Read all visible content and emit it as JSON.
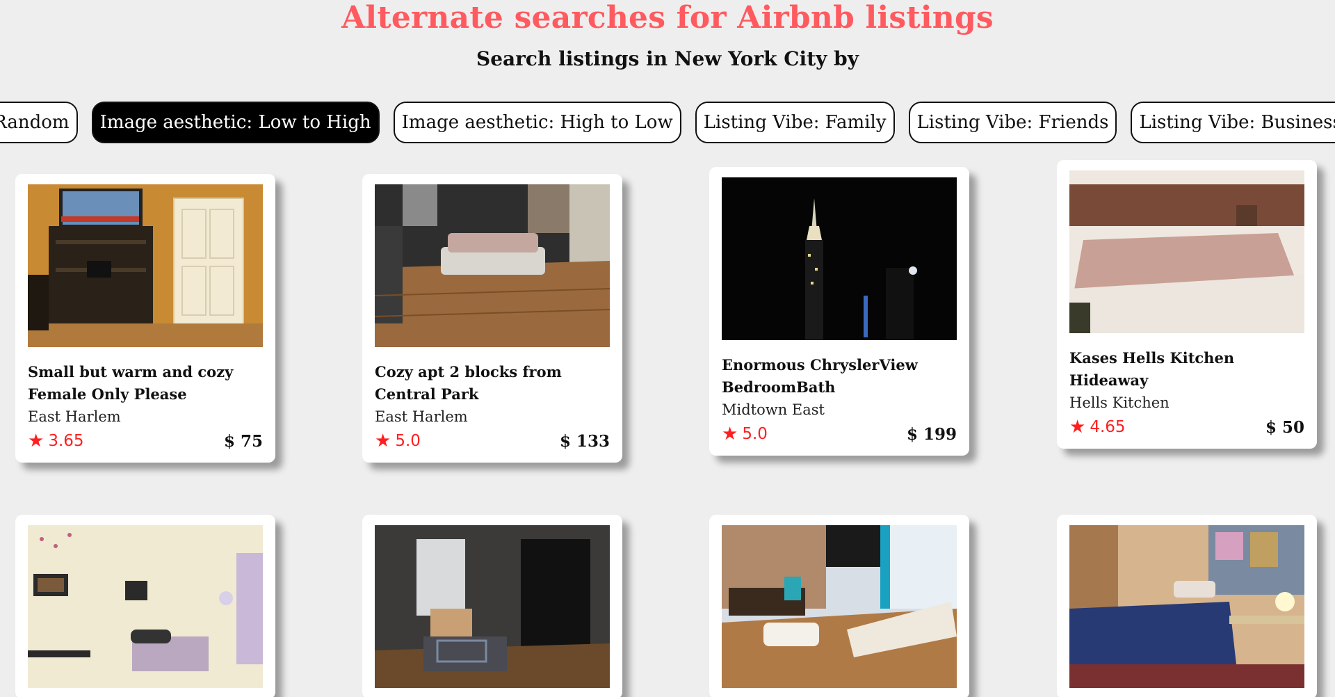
{
  "header": {
    "title": "Alternate searches for Airbnb listings",
    "subtitle": "Search listings in New York City by"
  },
  "filters": [
    {
      "label": "Random",
      "active": false
    },
    {
      "label": "Image aesthetic: Low to High",
      "active": true
    },
    {
      "label": "Image aesthetic: High to Low",
      "active": false
    },
    {
      "label": "Listing Vibe: Family",
      "active": false
    },
    {
      "label": "Listing Vibe: Friends",
      "active": false
    },
    {
      "label": "Listing Vibe: Business",
      "active": false
    }
  ],
  "listings": [
    {
      "title": "Small but warm and cozy Female Only Please",
      "neighborhood": "East Harlem",
      "rating": "3.65",
      "price": "$ 75"
    },
    {
      "title": "Cozy apt 2 blocks from Central Park",
      "neighborhood": "East Harlem",
      "rating": "5.0",
      "price": "$ 133"
    },
    {
      "title": "Enormous ChryslerView BedroomBath",
      "neighborhood": "Midtown East",
      "rating": "5.0",
      "price": "$ 199"
    },
    {
      "title": "Kases Hells Kitchen Hideaway",
      "neighborhood": "Hells Kitchen",
      "rating": "4.65",
      "price": "$ 50"
    },
    {
      "title": "",
      "neighborhood": "",
      "rating": "",
      "price": ""
    },
    {
      "title": "",
      "neighborhood": "",
      "rating": "",
      "price": ""
    },
    {
      "title": "",
      "neighborhood": "",
      "rating": "",
      "price": ""
    },
    {
      "title": "",
      "neighborhood": "",
      "rating": "",
      "price": ""
    }
  ],
  "colors": {
    "brand": "#ff5a5f",
    "rating": "#ff1f1f",
    "background": "#eeeeee"
  },
  "icons": {
    "rating": "star-icon"
  }
}
